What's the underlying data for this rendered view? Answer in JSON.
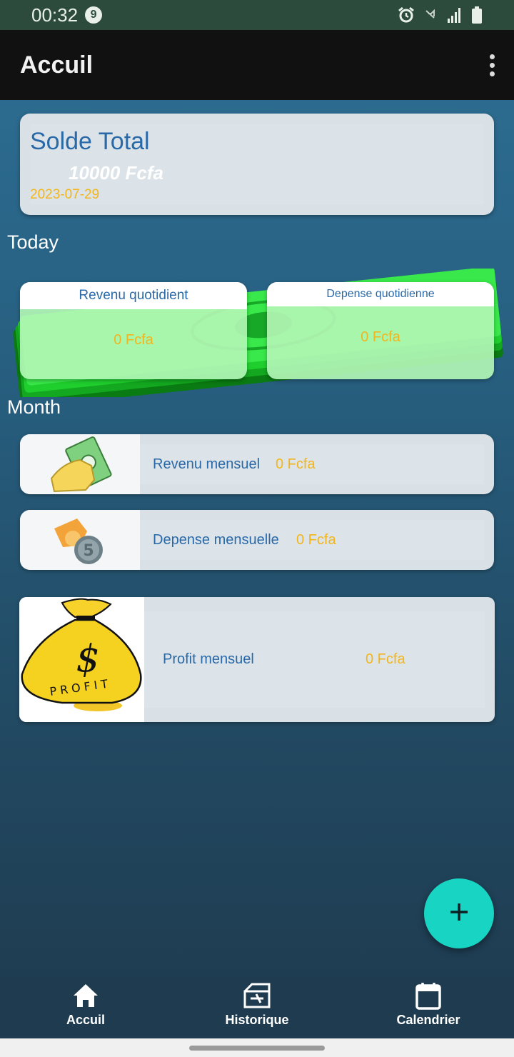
{
  "status_bar": {
    "time": "00:32",
    "notification_count": "9",
    "icons": [
      "alarm-icon",
      "mute-icon",
      "signal-icon",
      "battery-icon"
    ]
  },
  "app_bar": {
    "title": "Accuil",
    "menu_icon": "more-vert-icon"
  },
  "solde": {
    "title": "Solde Total",
    "amount": "10000 Fcfa",
    "date": "2023-07-29"
  },
  "sections": {
    "today": "Today",
    "month": "Month"
  },
  "daily": {
    "income": {
      "label": "Revenu quotidient",
      "value": "0 Fcfa"
    },
    "expense": {
      "label": "Depense quotidienne",
      "value": "0 Fcfa"
    }
  },
  "monthly": {
    "income": {
      "label": "Revenu mensuel",
      "value": "0 Fcfa",
      "icon": "money-hand-icon"
    },
    "expense": {
      "label": "Depense mensuelle",
      "value": "0 Fcfa",
      "icon": "coin-hand-icon"
    },
    "profit": {
      "label": "Profit mensuel",
      "value": "0 Fcfa",
      "icon": "profit-bag-icon",
      "bag_text": "PROFIT"
    }
  },
  "fab": {
    "icon": "plus-icon"
  },
  "bottom_nav": [
    {
      "label": "Accuil",
      "icon": "home-icon"
    },
    {
      "label": "Historique",
      "icon": "history-icon"
    },
    {
      "label": "Calendrier",
      "icon": "calendar-icon"
    }
  ],
  "colors": {
    "accent_blue": "#2a69a8",
    "accent_gold": "#f2b51c",
    "fab": "#18d4c3",
    "app_bar": "#111111"
  }
}
